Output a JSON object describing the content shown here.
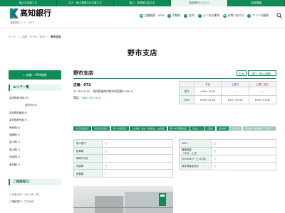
{
  "topnav": {
    "tabs": [
      {
        "label": "個人のお客さま",
        "active": false
      },
      {
        "label": "法人・個人事業主のお客さま",
        "active": false
      },
      {
        "label": "株主・投資家の皆さま",
        "active": false
      },
      {
        "label": "高知銀行について",
        "active": true
      },
      {
        "label": "採用情報",
        "active": false
      }
    ]
  },
  "header": {
    "logo_text": "高知銀行",
    "bank_code": "金融機関コード：0578",
    "links": [
      {
        "icon": "location-icon",
        "glyph": "●",
        "label": "店舗検索・ATM"
      },
      {
        "icon": "fee-icon",
        "glyph": "¥",
        "label": "手数料"
      },
      {
        "icon": "rate-icon",
        "glyph": "%",
        "label": "金利"
      },
      {
        "icon": "faq-icon",
        "glyph": "?",
        "label": "よくある質問"
      },
      {
        "icon": "phone-icon",
        "glyph": "☎",
        "label": "お問い合わせ"
      },
      {
        "icon": "sitemap-icon",
        "glyph": "≡",
        "label": "サイト内検索"
      }
    ]
  },
  "breadcrumb": {
    "items": [
      "ホーム",
      "店舗・ATMのご案内",
      "野市支店"
    ],
    "separator": "＞"
  },
  "page_title": "野市支店",
  "sidebar": {
    "search_label": "店舗・ATM検索",
    "area_heading": "エリア一覧",
    "areas": [
      {
        "label": "高知県県中部(29)",
        "indent": false
      },
      {
        "label": "高知市(30)",
        "indent": true
      },
      {
        "label": "高知県県東部(4)",
        "indent": false
      },
      {
        "label": "高知県県西部(7)",
        "indent": false
      },
      {
        "label": "徳島県(4)",
        "indent": false
      },
      {
        "label": "愛媛県(2)",
        "indent": false
      },
      {
        "label": "香川県(1)",
        "indent": false
      },
      {
        "label": "岡山県(1)",
        "indent": false
      },
      {
        "label": "大阪府(1)",
        "indent": false
      },
      {
        "label": "東京都(1)",
        "indent": false
      }
    ],
    "guide_heading": "ご相談窓口",
    "guides": [
      {
        "label": "こうぎんローンセンター(2)"
      },
      {
        "label": "ご相談窓口・プラザ(3)"
      }
    ]
  },
  "branch": {
    "name": "野市支店",
    "badge_atm": "ATM",
    "badge_window": "窓口（有人店舗）",
    "store_no": "店番：072",
    "address": "〒 781-5232　高知県香南市野市町西野2708-11",
    "tel_label": "電話：",
    "tel": "0887-56-2105"
  },
  "hours": {
    "headers": [
      "",
      "平日",
      "土曜日",
      "日曜・祝日"
    ],
    "rows": [
      {
        "label": "窓口",
        "weekday": "9:00～15:00",
        "sat": "ー",
        "sun": "ー"
      },
      {
        "label": "ATM",
        "weekday": "8:00～21:00",
        "sat": "8:00～21:00",
        "sun": "8:00～21:00"
      }
    ]
  },
  "tags": [
    {
      "label": "外貨両替取扱店",
      "on": true
    },
    {
      "label": "投資信託取扱店",
      "on": true
    },
    {
      "label": "個人年金取扱店",
      "on": true
    },
    {
      "label": "公共料金・税金・各種料金　公金取扱",
      "on": true
    },
    {
      "label": "個人向け国債取扱店",
      "on": true
    },
    {
      "label": "住宅ローン",
      "on": true
    },
    {
      "label": "貸金庫",
      "on": true
    },
    {
      "label": "夜間金庫",
      "on": true
    },
    {
      "label": "土日営業",
      "on": false
    },
    {
      "label": "平日夜間・休日相談（一部窓口）",
      "on": false
    }
  ],
  "facilities_left": [
    {
      "label": "有人窓口",
      "value": "〇"
    },
    {
      "label": "駐車場",
      "value": "〇"
    },
    {
      "label": "車椅子対応",
      "value": "ー"
    },
    {
      "label": "貸金庫",
      "value": "〇"
    },
    {
      "label": "両替機",
      "value": "ー"
    }
  ],
  "facilities_right": [
    {
      "label": "ATM",
      "value": "〇"
    },
    {
      "label": "通帳繰越\n（平日・土日）",
      "value": "〇"
    },
    {
      "label": "AYOUNEサービス対応",
      "value": "〇"
    },
    {
      "label": "視覚障害者対応",
      "value": "〇"
    }
  ],
  "colors": {
    "brand_green": "#0f8c55",
    "light_green": "#e9f5ef",
    "saturday": "#1b64b5",
    "sunday": "#d0211b"
  }
}
